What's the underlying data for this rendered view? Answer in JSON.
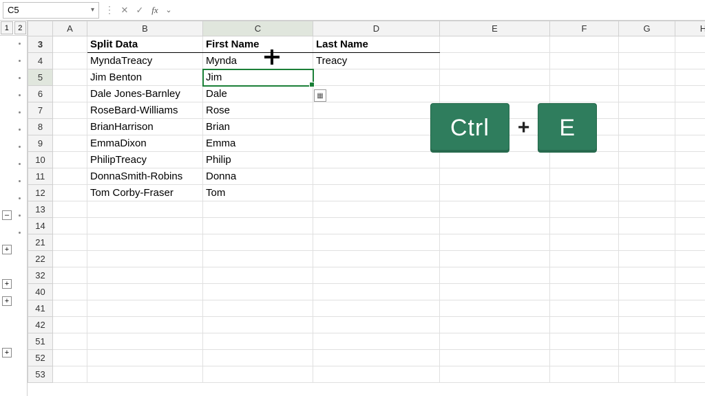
{
  "formula_bar": {
    "cell_ref": "C5",
    "value": ""
  },
  "outline": {
    "levels": [
      "1",
      "2"
    ],
    "collapse_label": "–",
    "expand_label": "+"
  },
  "columns": [
    "A",
    "B",
    "C",
    "D",
    "E",
    "F",
    "G",
    "H"
  ],
  "visible_rows": [
    3,
    4,
    5,
    6,
    7,
    8,
    9,
    10,
    11,
    12,
    13,
    14,
    21,
    22,
    32,
    40,
    41,
    42,
    51,
    52,
    53
  ],
  "selected_row": 5,
  "selected_col": "C",
  "headers": {
    "B": "Split Data",
    "C": "First Name",
    "D": "Last Name"
  },
  "rows": {
    "4": {
      "B": "MyndaTreacy",
      "C": "Mynda",
      "D": "Treacy"
    },
    "5": {
      "B": "Jim Benton",
      "C": "Jim",
      "D": ""
    },
    "6": {
      "B": "Dale Jones-Barnley",
      "C": "Dale",
      "D": ""
    },
    "7": {
      "B": "RoseBard-Williams",
      "C": "Rose",
      "D": ""
    },
    "8": {
      "B": "BrianHarrison",
      "C": "Brian",
      "D": ""
    },
    "9": {
      "B": "EmmaDixon",
      "C": "Emma",
      "D": ""
    },
    "10": {
      "B": "PhilipTreacy",
      "C": "Philip",
      "D": ""
    },
    "11": {
      "B": "DonnaSmith-Robins",
      "C": "Donna",
      "D": ""
    },
    "12": {
      "B": "Tom Corby-Fraser",
      "C": "Tom",
      "D": ""
    }
  },
  "shortcut": {
    "key1": "Ctrl",
    "plus": "+",
    "key2": "E"
  },
  "flash_fill_icon": "▦"
}
